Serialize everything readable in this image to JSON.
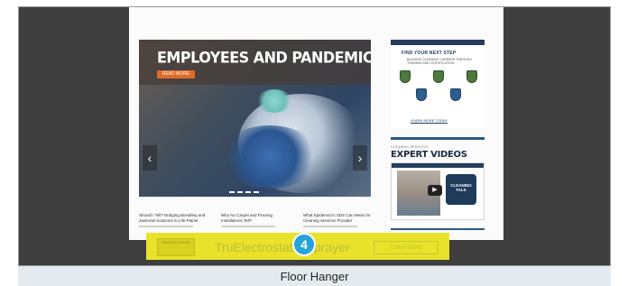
{
  "hero": {
    "title": "EMPLOYEES AND PANDEMIC",
    "button_label": "READ MORE",
    "prev_glyph": "‹",
    "next_glyph": "›",
    "dot_count": 4
  },
  "articles": [
    {
      "title": "Should I Tell? Bridging Biosafety and Janitorial Solutions to Life-Planet"
    },
    {
      "title": "Why No Carpet and Flooring Installations Tell?"
    },
    {
      "title": "What Epidemics's SDS Can Mean for Cleaning Services Provider"
    }
  ],
  "sidebar": {
    "promo_title": "FIND YOUR NEXT STEP",
    "promo_subtitle": "BUILDING CLEANING CAREERS THROUGH TRAINING AND CERTIFICATION",
    "promo_link": "LEARN MORE TODAY",
    "expert_kicker": "CLEANING SERVICES",
    "expert_heading": "EXPERT VIDEOS",
    "video_play_glyph": "▶",
    "video_badge_text": "CLEANING TALK"
  },
  "banner": {
    "logo_text": "PROTECT EDGE",
    "text": "TruElectrostatic Sprayer",
    "cta_label": "Learn More",
    "color": "#e8e22a"
  },
  "number_badge": {
    "label": "4",
    "color": "#27a3db"
  },
  "caption": {
    "text": "Floor Hanger"
  }
}
